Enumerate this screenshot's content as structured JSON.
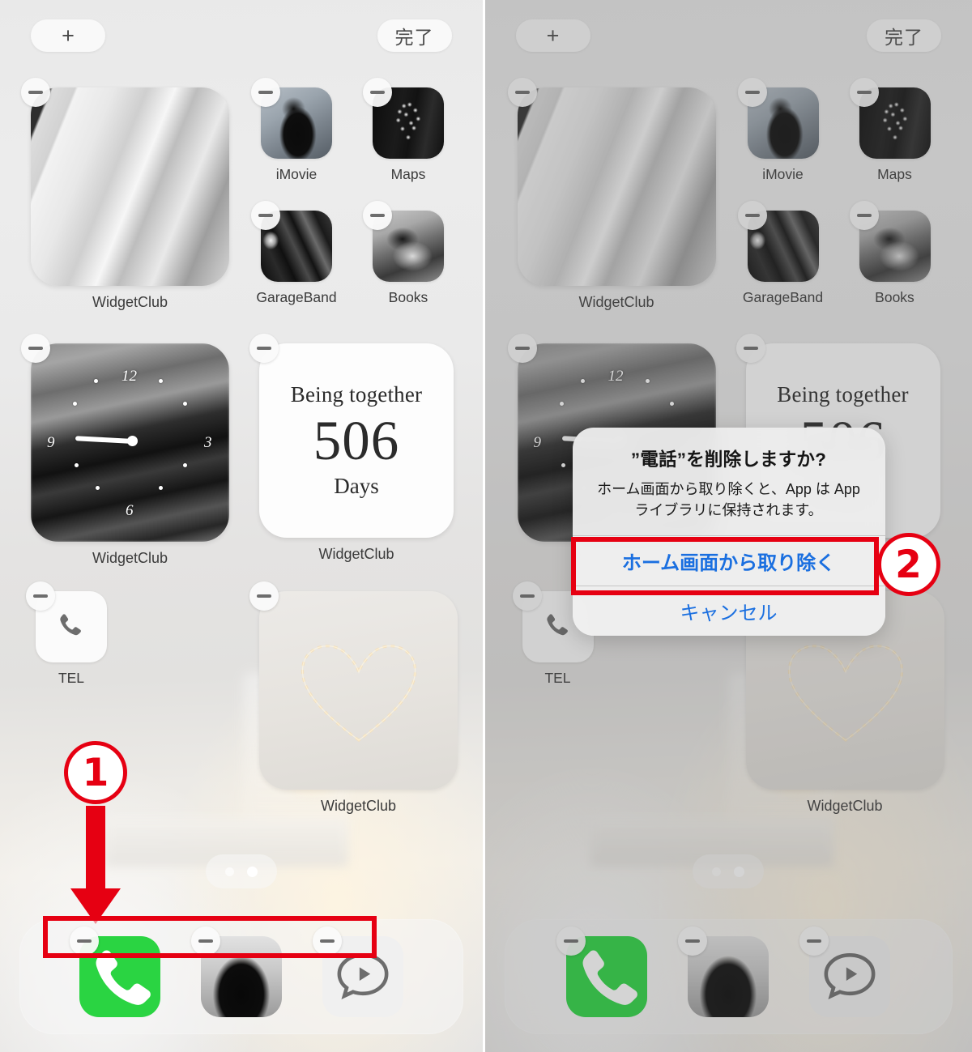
{
  "panels": [
    {
      "id": "left",
      "state": "jiggle-mode",
      "dimmed": false,
      "topbar": {
        "add_label": "+",
        "done_label": "完了"
      },
      "widgets": [
        {
          "name": "photo-bar-widget",
          "label": "WidgetClub",
          "kind": "photo"
        },
        {
          "name": "clock-widget",
          "label": "WidgetClub",
          "kind": "clock",
          "numerals": [
            "12",
            "3",
            "6",
            "9"
          ]
        },
        {
          "name": "days-counter-widget",
          "label": "WidgetClub",
          "kind": "days",
          "title": "Being together",
          "count": "506",
          "unit": "Days"
        },
        {
          "name": "heart-photo-widget",
          "label": "WidgetClub",
          "kind": "photo-heart"
        }
      ],
      "apps": [
        {
          "name": "imovie",
          "label": "iMovie"
        },
        {
          "name": "maps",
          "label": "Maps"
        },
        {
          "name": "garageband",
          "label": "GarageBand"
        },
        {
          "name": "books",
          "label": "Books"
        },
        {
          "name": "tel",
          "label": "TEL"
        }
      ],
      "dock": [
        {
          "name": "phone",
          "label": "Phone"
        },
        {
          "name": "photos-girl",
          "label": "Photos"
        },
        {
          "name": "messages",
          "label": "Messages"
        }
      ],
      "page_dots": {
        "count": 2,
        "active_index": 1
      },
      "remove_badge_glyph": "minus-badge"
    },
    {
      "id": "right",
      "state": "alert-open",
      "dimmed": true,
      "topbar": {
        "add_label": "+",
        "done_label": "完了"
      },
      "alert": {
        "title": "”電話”を削除しますか?",
        "message": "ホーム画面から取り除くと、App は App ライブラリに保持されます。",
        "buttons": [
          {
            "name": "remove-from-home-screen",
            "label": "ホーム画面から取り除く",
            "emphasis": "primary",
            "highlighted": true
          },
          {
            "name": "cancel",
            "label": "キャンセル",
            "emphasis": "normal",
            "highlighted": false
          }
        ]
      }
    }
  ],
  "annotations": [
    {
      "name": "step-1-marker",
      "number": "①",
      "digit": "1",
      "color": "#e60012",
      "shape": "circle-with-down-arrow",
      "target": "left-panel-dock-remove-badges"
    },
    {
      "name": "step-1-highlight-rect",
      "color": "#e60012",
      "shape": "rectangle",
      "target": "left-panel-dock-remove-badges"
    },
    {
      "name": "step-2-marker",
      "number": "②",
      "digit": "2",
      "color": "#e60012",
      "shape": "circle",
      "target": "remove-from-home-screen-button"
    },
    {
      "name": "step-2-highlight-rect",
      "color": "#e60012",
      "shape": "rectangle",
      "target": "remove-from-home-screen-button"
    }
  ],
  "colors": {
    "annotation_red": "#e60012",
    "link_blue": "#1a6fe0",
    "phone_green": "#2ad442",
    "panel_background": "#e9e9e9",
    "dim_overlay": "rgba(90,90,90,0.26)"
  }
}
